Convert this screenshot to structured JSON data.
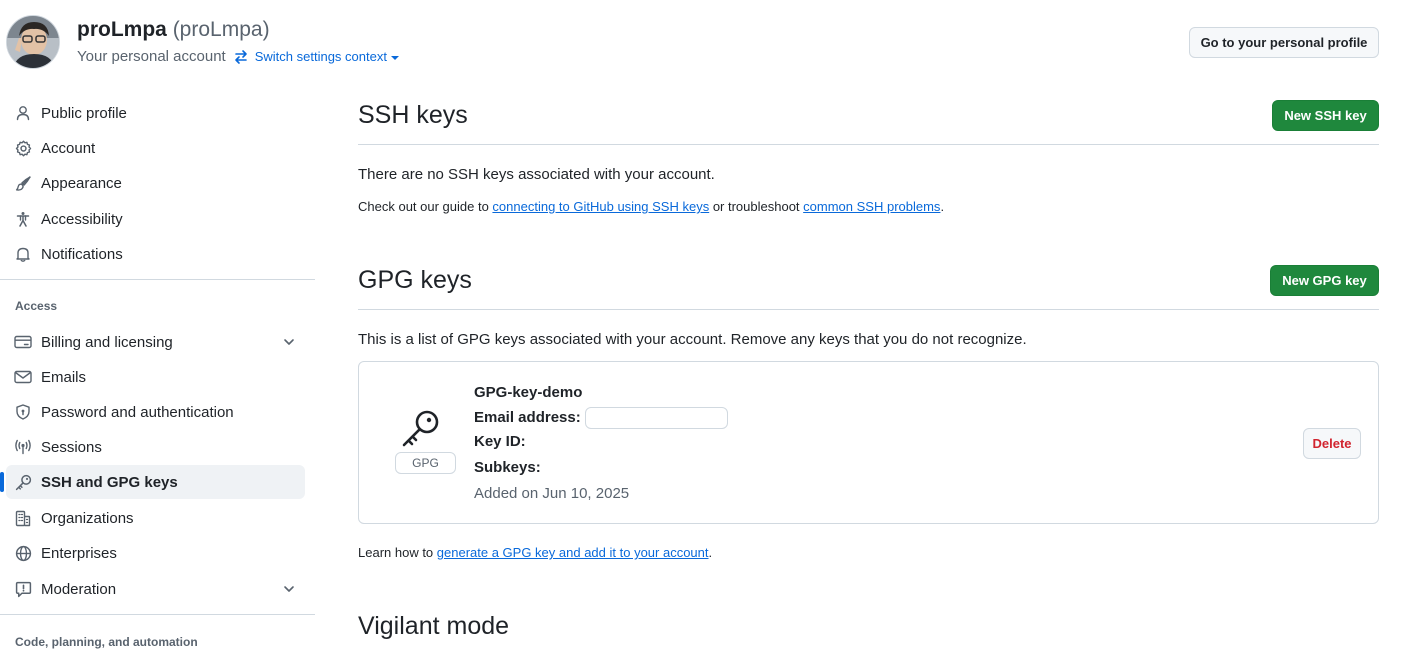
{
  "header": {
    "display_name": "proLmpa",
    "login": "(proLmpa)",
    "account_type": "Your personal account",
    "switch_context_label": "Switch settings context",
    "profile_button_label": "Go to your personal profile"
  },
  "sidebar": {
    "items_top": [
      {
        "label": "Public profile",
        "icon": "person-icon"
      },
      {
        "label": "Account",
        "icon": "gear-icon"
      },
      {
        "label": "Appearance",
        "icon": "paintbrush-icon"
      },
      {
        "label": "Accessibility",
        "icon": "accessibility-icon"
      },
      {
        "label": "Notifications",
        "icon": "bell-icon"
      }
    ],
    "access_label": "Access",
    "items_access": [
      {
        "label": "Billing and licensing",
        "icon": "credit-card-icon",
        "expandable": true
      },
      {
        "label": "Emails",
        "icon": "mail-icon"
      },
      {
        "label": "Password and authentication",
        "icon": "shield-lock-icon"
      },
      {
        "label": "Sessions",
        "icon": "broadcast-icon"
      },
      {
        "label": "SSH and GPG keys",
        "icon": "key-icon",
        "active": true
      },
      {
        "label": "Organizations",
        "icon": "organization-icon"
      },
      {
        "label": "Enterprises",
        "icon": "globe-icon"
      },
      {
        "label": "Moderation",
        "icon": "report-icon",
        "expandable": true
      }
    ],
    "code_label": "Code, planning, and automation"
  },
  "ssh": {
    "title": "SSH keys",
    "new_button": "New SSH key",
    "empty_text": "There are no SSH keys associated with your account.",
    "guide_prefix": "Check out our guide to ",
    "guide_link": "connecting to GitHub using SSH keys",
    "guide_middle": " or troubleshoot ",
    "problems_link": "common SSH problems",
    "guide_suffix": "."
  },
  "gpg": {
    "title": "GPG keys",
    "new_button": "New GPG key",
    "description": "This is a list of GPG keys associated with your account. Remove any keys that you do not recognize.",
    "key": {
      "badge": "GPG",
      "name": "GPG-key-demo",
      "email_label": "Email address:",
      "email_value": "",
      "key_id_label": "Key ID:",
      "key_id_value": "",
      "subkeys_label": "Subkeys:",
      "subkeys_value": "",
      "added": "Added on Jun 10, 2025",
      "delete_button": "Delete"
    },
    "learn_prefix": "Learn how to ",
    "learn_link": "generate a GPG key and add it to your account",
    "learn_suffix": "."
  },
  "vigilant": {
    "title": "Vigilant mode"
  },
  "colors": {
    "accent": "#0969da",
    "primary_button": "#1f883d",
    "danger": "#d1242f",
    "muted_text": "#59636e",
    "border": "#d1d9e0"
  }
}
